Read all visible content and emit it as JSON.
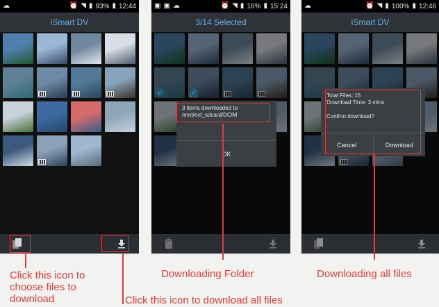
{
  "panels": [
    {
      "status": {
        "battery": "93%",
        "time": "12:44"
      },
      "title": "iSmart DV",
      "thumbs": [
        {
          "c1": "#4f7fae",
          "c2": "#1e5a2f",
          "video": false
        },
        {
          "c1": "#9bb7d6",
          "c2": "#384a68",
          "video": false
        },
        {
          "c1": "#6f879f",
          "c2": "#e0e7ed",
          "video": false
        },
        {
          "c1": "#d9dde4",
          "c2": "#4d5b6b",
          "video": false
        },
        {
          "c1": "#5f7f96",
          "c2": "#2d6a78",
          "video": false
        },
        {
          "c1": "#6f8aa6",
          "c2": "#2b3b50",
          "video": true
        },
        {
          "c1": "#537a98",
          "c2": "#29445d",
          "video": true
        },
        {
          "c1": "#88a3bc",
          "c2": "#3f3326",
          "video": true
        },
        {
          "c1": "#c9d1da",
          "c2": "#456f3a",
          "video": false
        },
        {
          "c1": "#3d6aa0",
          "c2": "#28476a",
          "video": false
        },
        {
          "c1": "#d66b6b",
          "c2": "#3a5f8a",
          "video": false
        },
        {
          "c1": "#8fa5b8",
          "c2": "#c8d1da",
          "video": false
        },
        {
          "c1": "#3c5a7f",
          "c2": "#cfd9e3",
          "video": false
        },
        {
          "c1": "#8aa2b7",
          "c2": "#2d425a",
          "video": true
        },
        {
          "c1": "#9fb7cf",
          "c2": "#5a6a78",
          "video": false
        }
      ],
      "toolbar": [
        "multi-select-icon",
        "download-icon"
      ]
    },
    {
      "status": {
        "battery": "16%",
        "time": "15:24"
      },
      "title": "3/14 Selected",
      "dialog": {
        "line1": "3 items downloaded to",
        "line2": "/mnt/ext_sdcard/DCIM",
        "ok": "OK"
      },
      "toolbar": [
        "trash-icon",
        "download-icon"
      ]
    },
    {
      "status": {
        "battery": "100%",
        "time": "12:46"
      },
      "title": "iSmart DV",
      "dialog": {
        "total": "Total Files: 15",
        "time": "Download Time: 3 mins",
        "confirm": "Confirm download?",
        "cancel": "Cancel",
        "download": "Download"
      },
      "toolbar": [
        "multi-select-icon",
        "download-icon"
      ]
    }
  ],
  "captions": {
    "choose": [
      "Click this icon to",
      "choose files to",
      "download"
    ],
    "download_all": "Click this icon to download all files",
    "folder": "Downloading Folder",
    "all": "Downloading all files"
  },
  "colors": {
    "accent": "#5fb2e6",
    "annotation": "#e23a3a"
  }
}
